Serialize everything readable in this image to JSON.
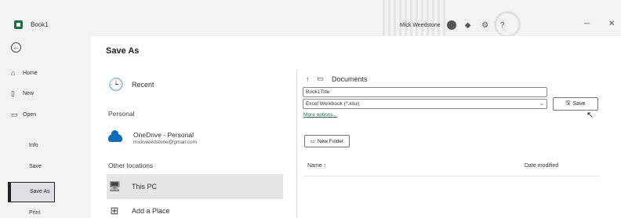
{
  "titlebar": {
    "book_title": "Book1",
    "user_name": "Mick Weedstone",
    "icons": [
      "excel-logo",
      "diamond-icon",
      "settings-icon",
      "help-icon",
      "minimize-icon",
      "close-icon"
    ]
  },
  "nav": {
    "back_icon": "back-arrow-icon",
    "items": [
      {
        "label": "Home",
        "icon": "home-icon"
      },
      {
        "label": "New",
        "icon": "new-doc-icon"
      },
      {
        "label": "Open",
        "icon": "folder-open-icon"
      }
    ],
    "plain_items": [
      "Info",
      "Save",
      "Save As",
      "Print"
    ],
    "selected": "Save As"
  },
  "main": {
    "page_title": "Save As",
    "locations": {
      "recent": "Recent",
      "personal_header": "Personal",
      "onedrive_name": "OneDrive - Personal",
      "onedrive_email": "mickweedstone@gmail.com",
      "other_header": "Other locations",
      "this_pc": "This PC",
      "add_place": "Add a Place"
    },
    "save_pane": {
      "breadcrumb_folder": "Documents",
      "file_name": "Book1Title",
      "file_type": "Excel Workbook (*.xlsx)",
      "more_options": "More options...",
      "save_label": "Save",
      "new_folder_label": "New Folder",
      "col_name": "Name",
      "col_name_sort": "↑",
      "col_date": "Date modified"
    }
  }
}
